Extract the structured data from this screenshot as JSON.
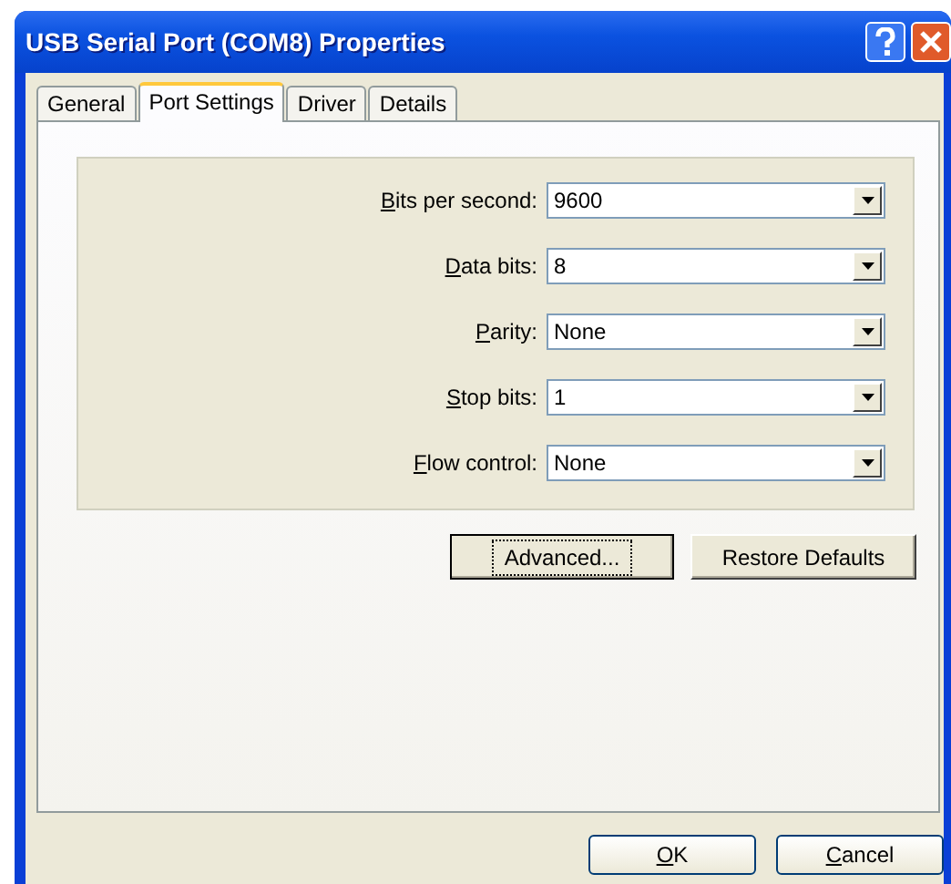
{
  "window": {
    "title": "USB Serial Port (COM8) Properties"
  },
  "tabs": [
    {
      "label": "General",
      "selected": false
    },
    {
      "label": "Port Settings",
      "selected": true
    },
    {
      "label": "Driver",
      "selected": false
    },
    {
      "label": "Details",
      "selected": false
    }
  ],
  "settings": [
    {
      "label": "Bits per second:",
      "value": "9600"
    },
    {
      "label": "Data bits:",
      "value": "8"
    },
    {
      "label": "Parity:",
      "value": "None"
    },
    {
      "label": "Stop bits:",
      "value": "1"
    },
    {
      "label": "Flow control:",
      "value": "None"
    }
  ],
  "panel_buttons": [
    {
      "label": "Advanced...",
      "focused": true
    },
    {
      "label": "Restore Defaults",
      "focused": false
    }
  ],
  "dialog_buttons": [
    "OK",
    "Cancel"
  ]
}
